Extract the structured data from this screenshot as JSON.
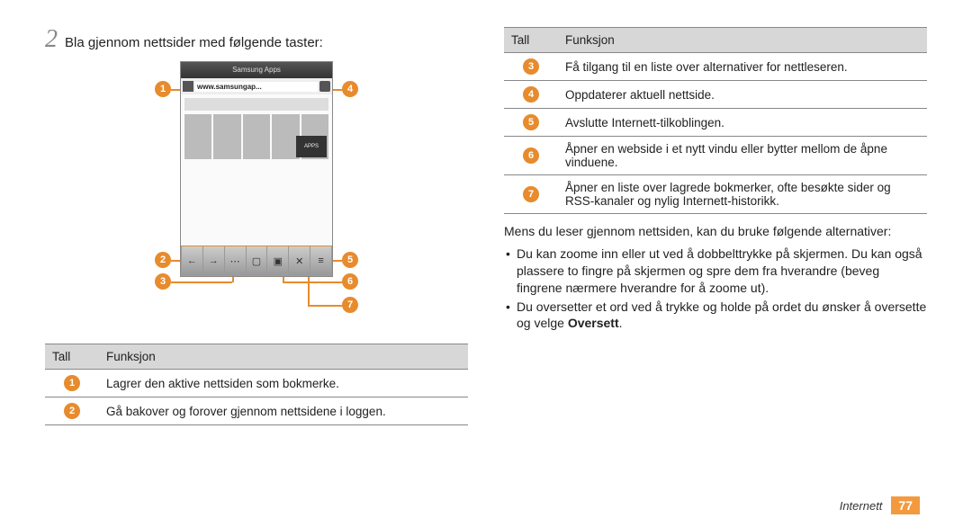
{
  "step": {
    "number": "2",
    "text": "Bla gjennom nettsider med følgende taster:"
  },
  "phone": {
    "title": "Samsung Apps",
    "url": "www.samsungap...",
    "apps_label": "APPS"
  },
  "table1": {
    "headers": {
      "num": "Tall",
      "func": "Funksjon"
    },
    "rows": [
      {
        "n": "1",
        "text": "Lagrer den aktive nettsiden som bokmerke."
      },
      {
        "n": "2",
        "text": "Gå bakover og forover gjennom nettsidene i loggen."
      }
    ]
  },
  "table2": {
    "headers": {
      "num": "Tall",
      "func": "Funksjon"
    },
    "rows": [
      {
        "n": "3",
        "text": "Få tilgang til en liste over alternativer for nettleseren."
      },
      {
        "n": "4",
        "text": "Oppdaterer aktuell nettside."
      },
      {
        "n": "5",
        "text": "Avslutte Internett-tilkoblingen."
      },
      {
        "n": "6",
        "text": "Åpner en webside i et nytt vindu eller bytter mellom de åpne vinduene."
      },
      {
        "n": "7",
        "text": "Åpner en liste over lagrede bokmerker, ofte besøkte sider og RSS-kanaler og nylig Internett-historikk."
      }
    ]
  },
  "para": "Mens du leser gjennom nettsiden, kan du bruke følgende alternativer:",
  "bullets": [
    "Du kan zoome inn eller ut ved å dobbelttrykke på skjermen. Du kan også plassere to fingre på skjermen og spre dem fra hverandre (beveg fingrene nærmere hverandre for å zoome ut).",
    "Du oversetter et ord ved å trykke og holde på ordet du ønsker å oversette og velge Oversett."
  ],
  "bullet2_prefix": "Du oversetter et ord ved å trykke og holde på ordet du ønsker å oversette og velge ",
  "bullet2_bold": "Oversett",
  "bullet2_suffix": ".",
  "footer": {
    "section": "Internett",
    "page": "77"
  },
  "callouts": [
    "1",
    "2",
    "3",
    "4",
    "5",
    "6",
    "7"
  ]
}
